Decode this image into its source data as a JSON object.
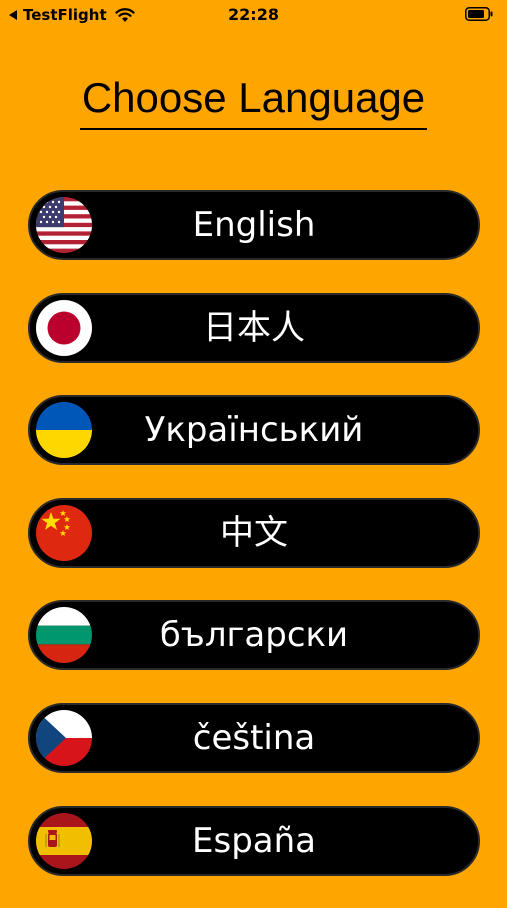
{
  "status_bar": {
    "back_label": "TestFlight",
    "time": "22:28",
    "icons": [
      "back-arrow-icon",
      "wifi-icon",
      "battery-icon"
    ]
  },
  "title": "Choose Language",
  "languages": [
    {
      "label": "English",
      "flag": "us-flag-icon"
    },
    {
      "label": "日本人",
      "flag": "japan-flag-icon"
    },
    {
      "label": "Український",
      "flag": "ukraine-flag-icon"
    },
    {
      "label": "中文",
      "flag": "china-flag-icon"
    },
    {
      "label": "български",
      "flag": "bulgaria-flag-icon"
    },
    {
      "label": "čeština",
      "flag": "czech-flag-icon"
    },
    {
      "label": "España",
      "flag": "spain-flag-icon"
    }
  ],
  "colors": {
    "background": "#FFA500",
    "button": "#000000",
    "button_text": "#FFFFFF"
  }
}
